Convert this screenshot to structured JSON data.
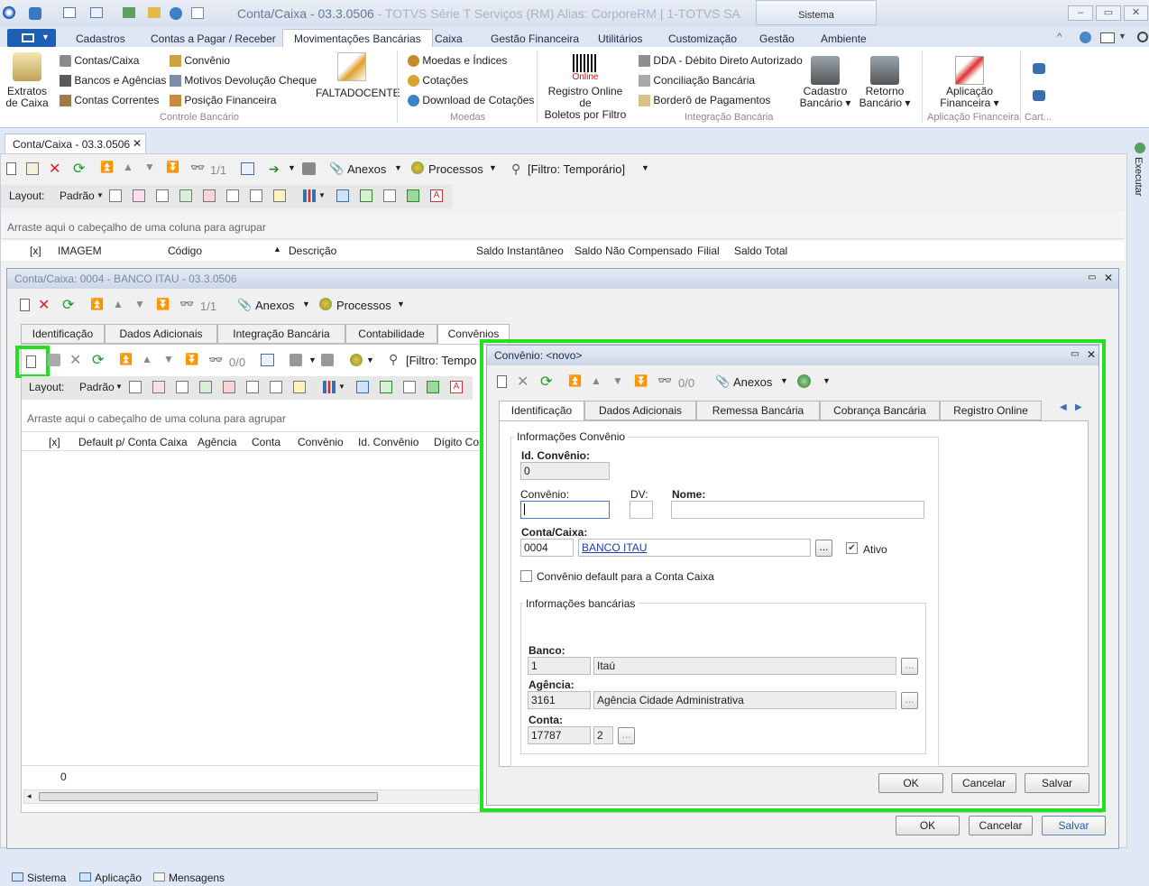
{
  "app": {
    "title": "Conta/Caixa - 03.3.0506",
    "title_dim": " - TOTVS Série T Serviços (RM) Alias: CorporeRM | 1-TOTVS SA",
    "sistema": "Sistema"
  },
  "menu": [
    "Cadastros",
    "Contas a Pagar / Receber",
    "Movimentações Bancárias",
    "Caixa",
    "Gestão Financeira",
    "Utilitários",
    "Customização",
    "Gestão",
    "Ambiente"
  ],
  "ribbon": {
    "extratos": "Extratos de Caixa",
    "extratos1": "Extratos",
    "extratos2": "de Caixa",
    "contas_caixa": "Contas/Caixa",
    "bancos": "Bancos e Agências",
    "contas_correntes": "Contas Correntes",
    "convenio": "Convênio",
    "motivos": "Motivos Devolução Cheque",
    "posicao": "Posição Financeira",
    "falta": "FALTADOCENTE",
    "controle": "Controle Bancário",
    "moedas": "Moedas e Índices",
    "cotacoes": "Cotações",
    "download": "Download de Cotações",
    "moedas_group": "Moedas",
    "online": "Online",
    "registro1": "Registro Online de",
    "registro2": "Boletos por Filtro",
    "dda": "DDA - Débito Direto Autorizado",
    "conciliacao": "Conciliação Bancária",
    "bordero": "Borderô de Pagamentos",
    "integracao": "Integração Bancária",
    "cadastro1": "Cadastro",
    "cadastro2": "Bancário",
    "retorno1": "Retorno",
    "retorno2": "Bancário",
    "aplic1": "Aplicação",
    "aplic2": "Financeira",
    "aplic_group": "Aplicação Financeira",
    "cart": "Cart..."
  },
  "doc_tab": "Conta/Caixa - 03.3.0506",
  "executar": "Executar",
  "main_tb": {
    "page": "1/1",
    "anexos": "Anexos",
    "processos": "Processos",
    "filtro": "[Filtro: Temporário]"
  },
  "layout_tb": {
    "layout": "Layout:",
    "padrao": "Padrão"
  },
  "group_hint": "Arraste aqui o cabeçalho de uma coluna para agrupar",
  "main_cols": [
    "[x]",
    "IMAGEM",
    "Código",
    "Descrição",
    "Saldo Instantâneo",
    "Saldo Não Compensado",
    "Filial",
    "Saldo Total"
  ],
  "conta_dialog": {
    "title": "Conta/Caixa: 0004 - BANCO ITAU - 03.3.0506",
    "page": "1/1",
    "anexos": "Anexos",
    "processos": "Processos",
    "tabs": [
      "Identificação",
      "Dados Adicionais",
      "Integração Bancária",
      "Contabilidade",
      "Convênios"
    ],
    "sub_page": "0/0",
    "filtro": "[Filtro: Tempo",
    "layout": "Layout:",
    "padrao": "Padrão",
    "group_hint": "Arraste aqui o cabeçalho de uma coluna para agrupar",
    "cols": [
      "[x]",
      "Default p/ Conta Caixa",
      "Agência",
      "Conta",
      "Convênio",
      "Id. Convênio",
      "Dígito Conv"
    ],
    "count": "0",
    "ok": "OK",
    "cancelar": "Cancelar",
    "salvar": "Salvar"
  },
  "conv_dialog": {
    "title": "Convênio: <novo>",
    "page": "0/0",
    "anexos": "Anexos",
    "tabs": [
      "Identificação",
      "Dados Adicionais",
      "Remessa Bancária",
      "Cobrança Bancária",
      "Registro Online"
    ],
    "info_conv": "Informações Convênio",
    "id_label": "Id. Convênio:",
    "id_value": "0",
    "conv_label": "Convênio:",
    "dv_label": "DV:",
    "nome_label": "Nome:",
    "conta_label": "Conta/Caixa:",
    "conta_code": "0004",
    "conta_name": "BANCO ITAU",
    "ativo": "Ativo",
    "default_label": "Convênio default para a Conta Caixa",
    "info_banc": "Informações bancárias",
    "banco_label": "Banco:",
    "banco_code": "1",
    "banco_name": "Itaú",
    "agencia_label": "Agência:",
    "agencia_code": "3161",
    "agencia_name": "Agência Cidade Administrativa",
    "conta2_label": "Conta:",
    "conta2_num": "17787",
    "conta2_dv": "2",
    "dots": "...",
    "ok": "OK",
    "cancelar": "Cancelar",
    "salvar": "Salvar"
  },
  "status": {
    "sistema": "Sistema",
    "aplicacao": "Aplicação",
    "mensagens": "Mensagens"
  },
  "colors": {
    "highlight": "#22e022",
    "accent": "#1c5fb4"
  }
}
